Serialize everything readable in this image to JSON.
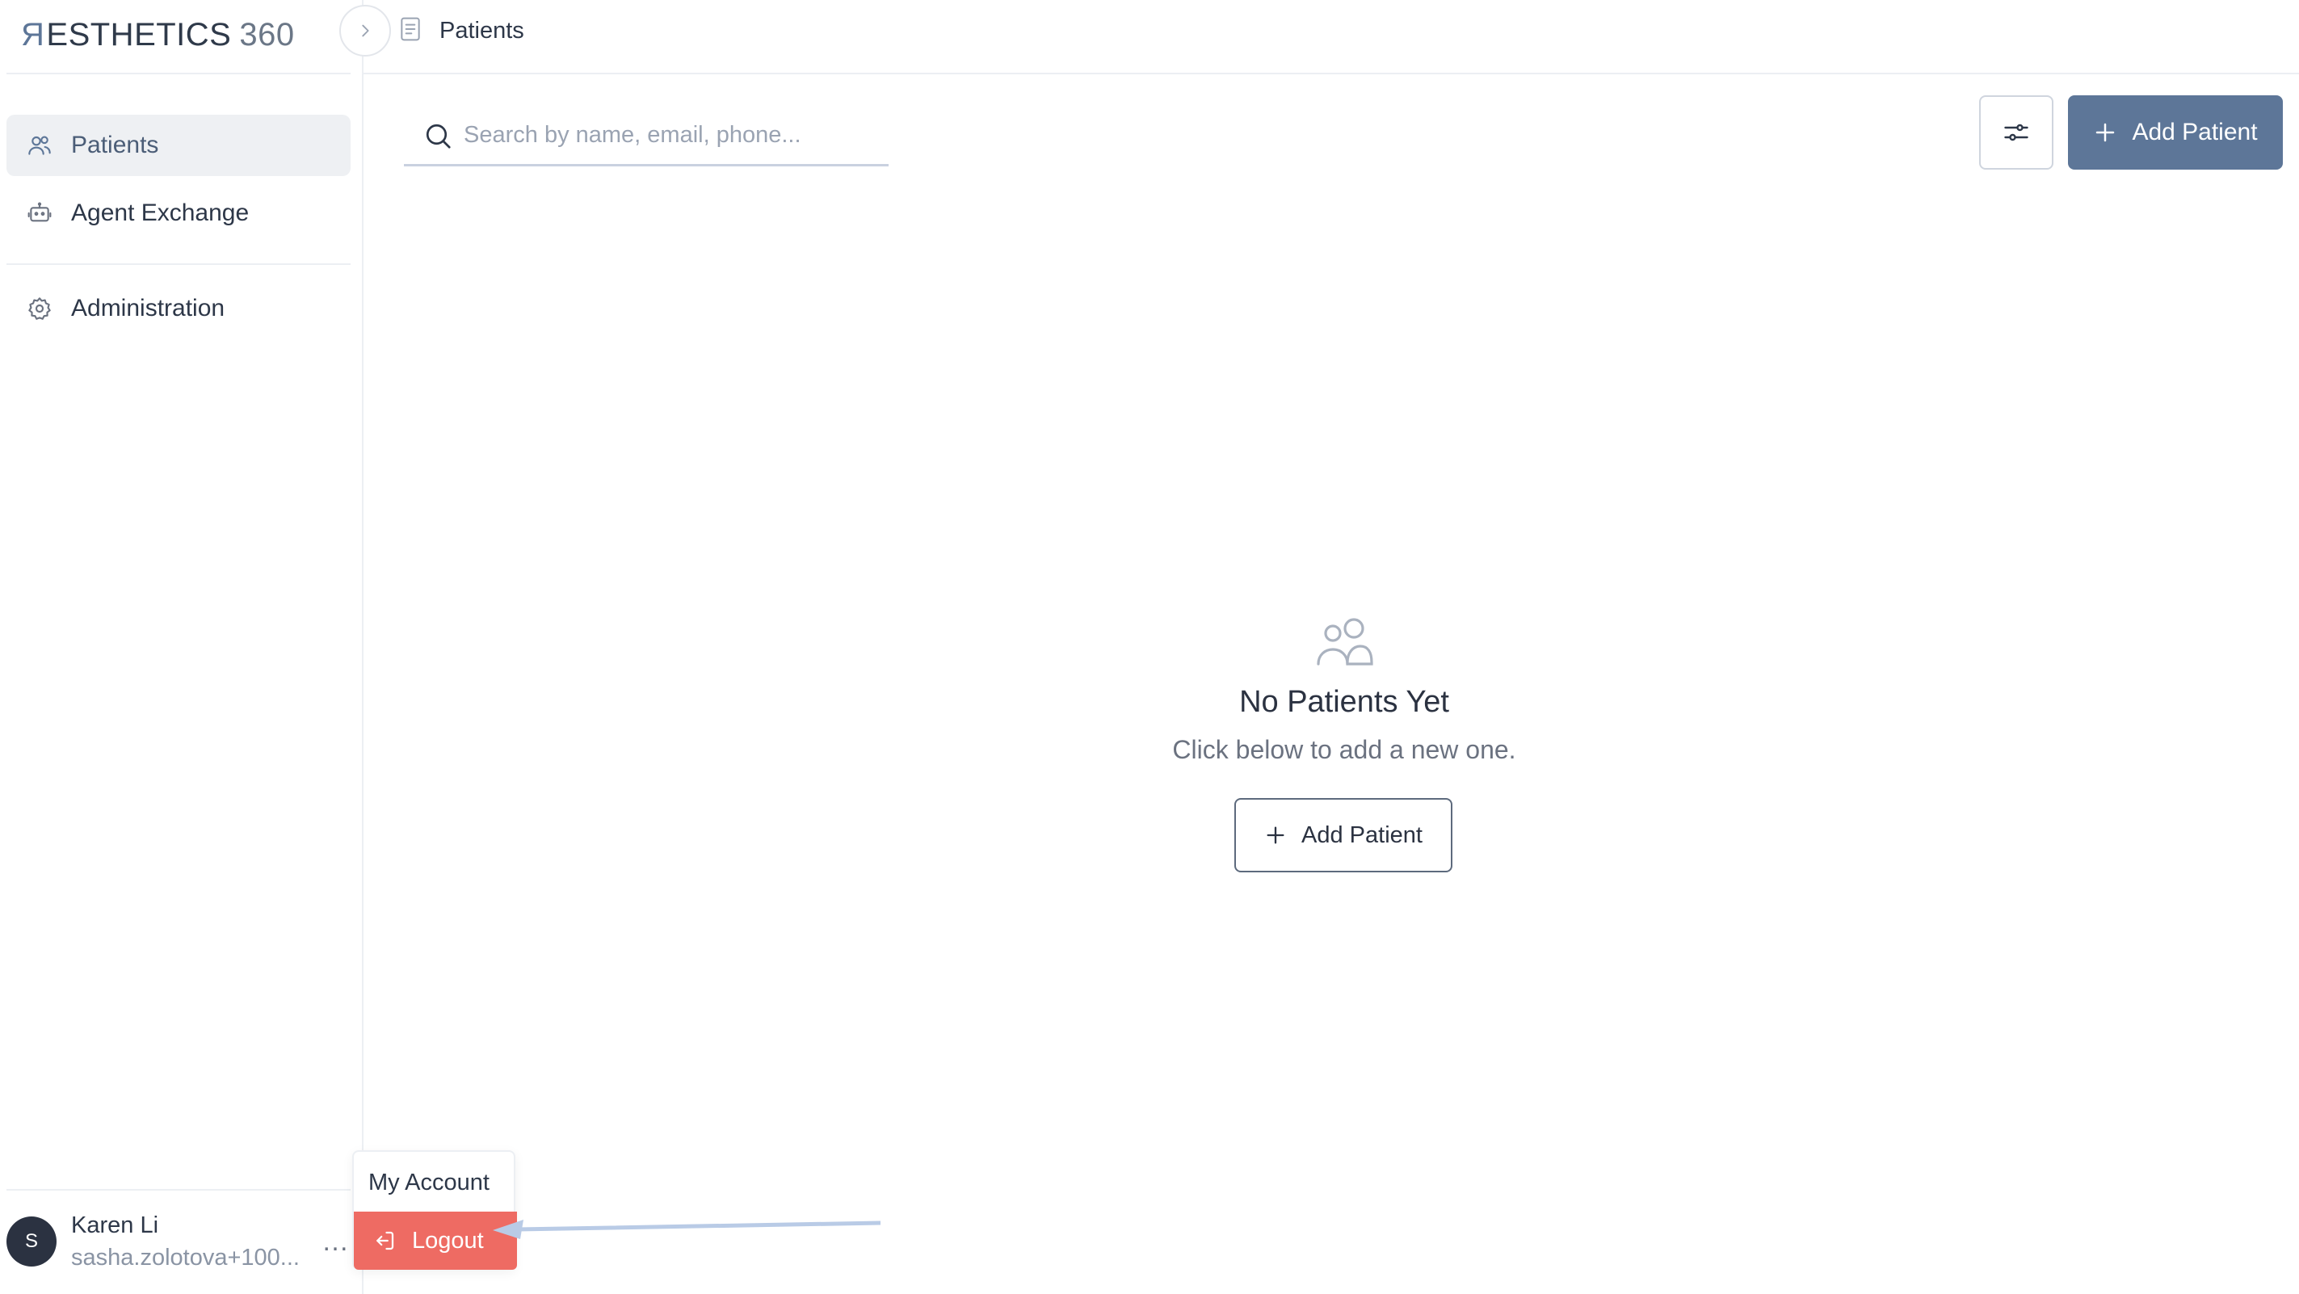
{
  "app": {
    "logo_main": "ESTHETICS",
    "logo_num": "360"
  },
  "sidebar": {
    "items": [
      {
        "label": "Patients",
        "icon": "users-icon",
        "active": true
      },
      {
        "label": "Agent Exchange",
        "icon": "bot-icon",
        "active": false
      },
      {
        "label": "Administration",
        "icon": "gear-icon",
        "active": false
      }
    ],
    "user": {
      "initial": "S",
      "name": "Karen Li",
      "email": "sasha.zolotova+100..."
    }
  },
  "header": {
    "breadcrumb": "Patients"
  },
  "search": {
    "placeholder": "Search by name, email, phone..."
  },
  "toolbar": {
    "add_label": "Add Patient"
  },
  "empty_state": {
    "title": "No Patients Yet",
    "subtitle": "Click below to add a new one.",
    "button_label": "Add Patient"
  },
  "user_menu": {
    "account_label": "My Account",
    "logout_label": "Logout"
  },
  "colors": {
    "accent": "#5d7698",
    "logout": "#ee6b63",
    "annotation_arrow": "#b9cbe6"
  }
}
